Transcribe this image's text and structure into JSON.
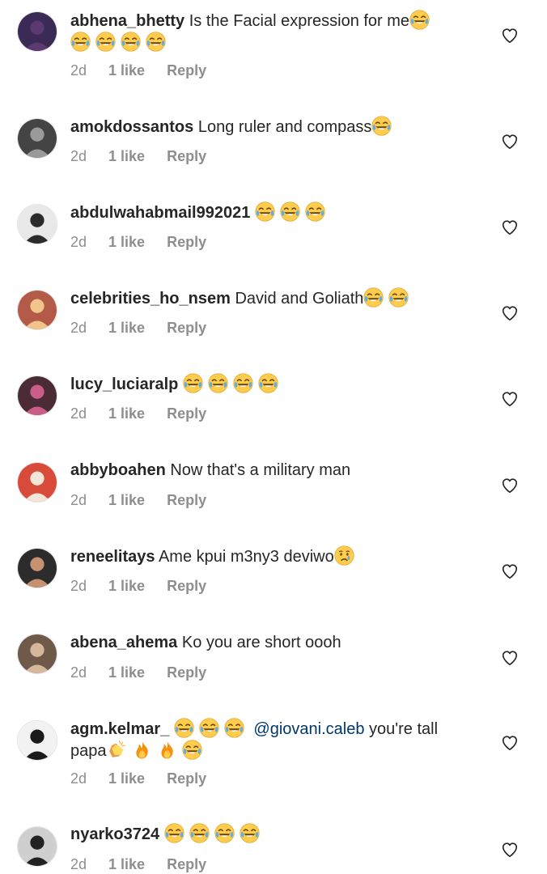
{
  "comments": [
    {
      "user": "abhena_bhetty",
      "text1": "Is the Facial expression for me",
      "emoji1": [
        "laugh"
      ],
      "emoji2": [
        "laugh",
        "laugh",
        "laugh",
        "laugh"
      ],
      "time": "2d",
      "likes": "1 like",
      "reply": "Reply"
    },
    {
      "user": "amokdossantos",
      "text1": "Long ruler and compass",
      "emoji1": [
        "laugh"
      ],
      "time": "2d",
      "likes": "1 like",
      "reply": "Reply"
    },
    {
      "user": "abdulwahabmail992021",
      "text1": "",
      "emoji1": [
        "laugh",
        "laugh",
        "laugh"
      ],
      "time": "2d",
      "likes": "1 like",
      "reply": "Reply"
    },
    {
      "user": "celebrities_ho_nsem",
      "text1": "David and Goliath",
      "emoji1": [
        "laugh",
        "laugh"
      ],
      "time": "2d",
      "likes": "1 like",
      "reply": "Reply"
    },
    {
      "user": "lucy_luciaralp",
      "text1": "",
      "emoji1": [
        "laugh",
        "laugh",
        "laugh",
        "laugh"
      ],
      "time": "2d",
      "likes": "1 like",
      "reply": "Reply"
    },
    {
      "user": "abbyboahen",
      "text1": "Now that's a military man",
      "emoji1": [],
      "time": "2d",
      "likes": "1 like",
      "reply": "Reply"
    },
    {
      "user": "reneelitays",
      "text1": "Ame kpui m3ny3 deviwo",
      "emoji1": [
        "cry"
      ],
      "time": "2d",
      "likes": "1 like",
      "reply": "Reply"
    },
    {
      "user": "abena_ahema",
      "text1": "Ko you are short oooh",
      "emoji1": [],
      "time": "2d",
      "likes": "1 like",
      "reply": "Reply"
    },
    {
      "user": "agm.kelmar_",
      "text1": "",
      "emoji1": [
        "laugh",
        "laugh",
        "laugh"
      ],
      "mention": "@giovani.caleb",
      "text_after": "you're tall",
      "text2": "papa",
      "emoji2": [
        "clap",
        "fire",
        "fire",
        "laugh"
      ],
      "time": "2d",
      "likes": "1 like",
      "reply": "Reply"
    },
    {
      "user": "nyarko3724",
      "text1": "",
      "emoji1": [
        "laugh",
        "laugh",
        "laugh",
        "laugh"
      ],
      "time": "2d",
      "likes": "1 like",
      "reply": "Reply"
    }
  ],
  "colors": {
    "text": "#262626",
    "meta": "#8e8e8e",
    "mention": "#00376b"
  }
}
